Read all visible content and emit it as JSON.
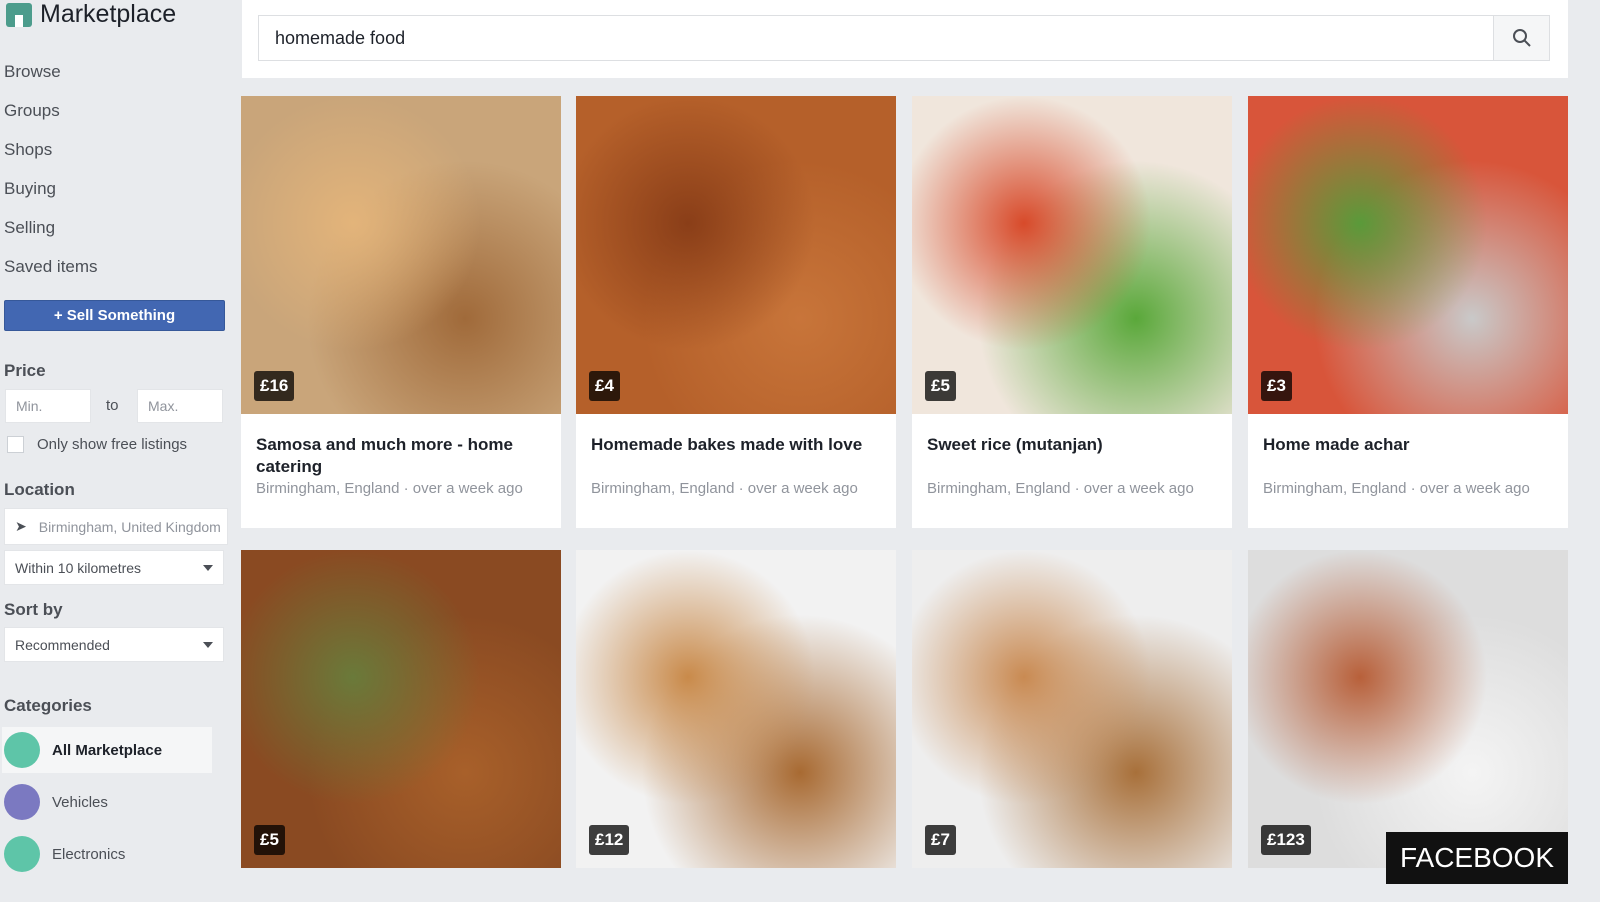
{
  "sidebar": {
    "title": "Marketplace",
    "nav": [
      "Browse",
      "Groups",
      "Shops",
      "Buying",
      "Selling",
      "Saved items"
    ],
    "sell_label": "+ Sell Something",
    "price_heading": "Price",
    "min_placeholder": "Min.",
    "to": "to",
    "max_placeholder": "Max.",
    "free_only": "Only show free listings",
    "location_heading": "Location",
    "location_value": "Birmingham, United Kingdom",
    "radius": "Within 10 kilometres",
    "sort_heading": "Sort by",
    "sort_value": "Recommended",
    "categories_heading": "Categories",
    "categories": [
      {
        "label": "All Marketplace",
        "color": "#5ec5a8"
      },
      {
        "label": "Vehicles",
        "color": "#7b79c1"
      },
      {
        "label": "Electronics",
        "color": "#5ec5a8"
      }
    ]
  },
  "search": {
    "value": "homemade food"
  },
  "listings": [
    {
      "price": "£16",
      "title": "Samosa and much more - home catering",
      "meta": "Birmingham, England · over a week ago",
      "colors": [
        "#c9a57a",
        "#e3b47a",
        "#a06a3a"
      ]
    },
    {
      "price": "£4",
      "title": "Homemade bakes made with love",
      "meta": "Birmingham, England · over a week ago",
      "colors": [
        "#b5602a",
        "#8a3e18",
        "#c8753a"
      ]
    },
    {
      "price": "£5",
      "title": "Sweet rice (mutanjan)",
      "meta": "Birmingham, England · over a week ago",
      "colors": [
        "#f0e6dc",
        "#d84a2a",
        "#5aa83a"
      ]
    },
    {
      "price": "£3",
      "title": "Home made achar",
      "meta": "Birmingham, England · over a week ago",
      "colors": [
        "#d8553a",
        "#5a9a3a",
        "#c9c9c9"
      ]
    },
    {
      "price": "£5",
      "colors": [
        "#8a4a22",
        "#6a7a3a",
        "#a8602a"
      ]
    },
    {
      "price": "£12",
      "colors": [
        "#f2f2f2",
        "#c98a4a",
        "#a86a32"
      ]
    },
    {
      "price": "£7",
      "colors": [
        "#eee",
        "#c98a52",
        "#a8703a"
      ]
    },
    {
      "price": "£123",
      "colors": [
        "#ddd",
        "#b8603a",
        "#f4f4f4"
      ]
    }
  ],
  "watermark": "FACEBOOK"
}
